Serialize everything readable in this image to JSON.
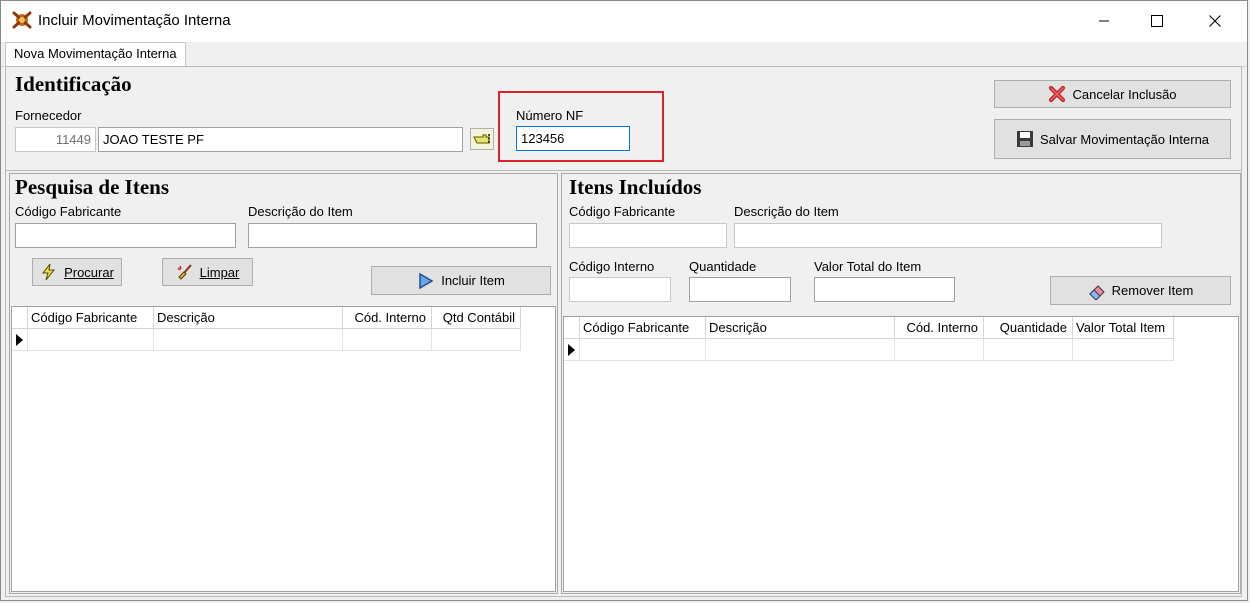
{
  "window": {
    "title": "Incluir Movimentação Interna",
    "controls": {
      "minimize_icon": "minimize-icon",
      "maximize_icon": "maximize-icon",
      "close_icon": "close-icon"
    }
  },
  "tabs": [
    {
      "label": "Nova Movimentação Interna",
      "active": true
    }
  ],
  "identificacao": {
    "heading": "Identificação",
    "fornecedor_label": "Fornecedor",
    "fornecedor_code": "11449",
    "fornecedor_name": "JOAO TESTE PF",
    "numero_nf_label": "Número NF",
    "numero_nf_value": "123456"
  },
  "actions": {
    "cancel_label": "Cancelar Inclusão",
    "save_label": "Salvar Movimentação Interna"
  },
  "pesquisa": {
    "heading": "Pesquisa de Itens",
    "codigo_fabricante_label": "Código Fabricante",
    "descricao_label": "Descrição do Item",
    "codigo_fabricante_value": "",
    "descricao_value": "",
    "procurar_label": "Procurar",
    "limpar_label": "Limpar",
    "incluir_label": "Incluir Item",
    "grid_columns": [
      "Código Fabricante",
      "Descrição",
      "Cód. Interno",
      "Qtd Contábil"
    ]
  },
  "incluidos": {
    "heading": "Itens Incluídos",
    "codigo_fabricante_label": "Código Fabricante",
    "descricao_label": "Descrição  do Item",
    "codigo_interno_label": "Código Interno",
    "quantidade_label": "Quantidade",
    "valor_total_label": "Valor Total do Item",
    "remover_label": "Remover Item",
    "grid_columns": [
      "Código Fabricante",
      "Descrição",
      "Cód. Interno",
      "Quantidade",
      "Valor Total Item"
    ]
  },
  "colors": {
    "highlight": "#d9242b",
    "focus_border": "#0078d7",
    "window_bg": "#f0f0f0"
  }
}
